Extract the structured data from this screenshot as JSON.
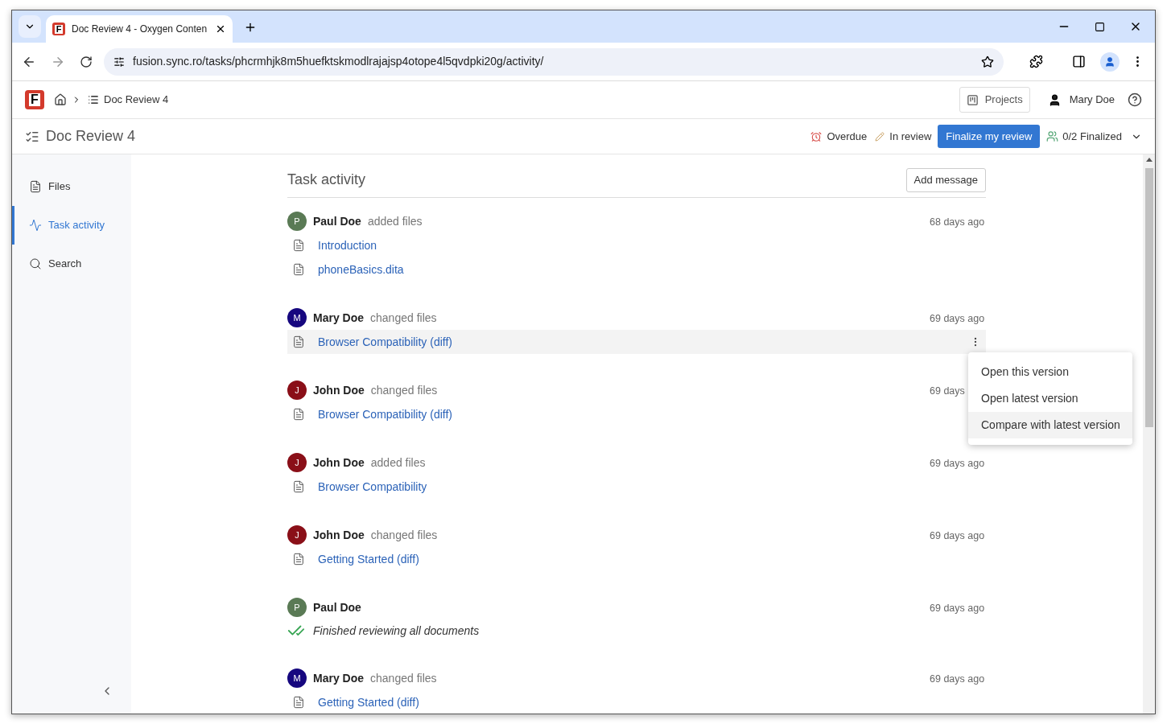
{
  "browser": {
    "tab": {
      "favicon_letter": "F",
      "title": "Doc Review 4 - Oxygen Conten"
    },
    "url": "fusion.sync.ro/tasks/phcrmhjk8m5huefktskmodlrajajsp4otope4l5qvdpki20g/activity/"
  },
  "app": {
    "logo_letter": "F",
    "breadcrumb": "Doc Review 4",
    "projects_button": "Projects",
    "user": "Mary Doe"
  },
  "task_header": {
    "title": "Doc Review 4",
    "overdue": "Overdue",
    "status": "In review",
    "finalize_button": "Finalize my review",
    "finalized": "0/2 Finalized"
  },
  "sidebar": {
    "items": [
      {
        "label": "Files",
        "selected": false
      },
      {
        "label": "Task activity",
        "selected": true
      },
      {
        "label": "Search",
        "selected": false
      }
    ]
  },
  "activity": {
    "title": "Task activity",
    "add_button": "Add message",
    "entries": [
      {
        "kind": "files",
        "initial": "P",
        "color": "#5a7a55",
        "user": "Paul Doe",
        "action": "added files",
        "time": "68 days ago",
        "files": [
          {
            "name": "Introduction",
            "selected": false
          },
          {
            "name": "phoneBasics.dita",
            "selected": false
          }
        ]
      },
      {
        "kind": "files",
        "initial": "M",
        "color": "#16077f",
        "user": "Mary Doe",
        "action": "changed files",
        "time": "69 days ago",
        "files": [
          {
            "name": "Browser Compatibility (diff)",
            "selected": true,
            "menu": [
              {
                "label": "Open this version",
                "selected": false
              },
              {
                "label": "Open latest version",
                "selected": false
              },
              {
                "label": "Compare with latest version",
                "selected": true
              }
            ]
          }
        ]
      },
      {
        "kind": "files",
        "initial": "J",
        "color": "#8a0f18",
        "user": "John Doe",
        "action": "changed files",
        "time": "69 days",
        "files": [
          {
            "name": "Browser Compatibility (diff)",
            "selected": false
          }
        ]
      },
      {
        "kind": "files",
        "initial": "J",
        "color": "#8a0f18",
        "user": "John Doe",
        "action": "added files",
        "time": "69 days ago",
        "files": [
          {
            "name": "Browser Compatibility",
            "selected": false
          }
        ]
      },
      {
        "kind": "files",
        "initial": "J",
        "color": "#8a0f18",
        "user": "John Doe",
        "action": "changed files",
        "time": "69 days ago",
        "files": [
          {
            "name": "Getting Started (diff)",
            "selected": false
          }
        ]
      },
      {
        "kind": "review",
        "initial": "P",
        "color": "#5a7a55",
        "user": "Paul Doe",
        "time": "69 days ago",
        "note": "Finished reviewing all documents"
      },
      {
        "kind": "files",
        "initial": "M",
        "color": "#16077f",
        "user": "Mary Doe",
        "action": "changed files",
        "time": "69 days ago",
        "files": [
          {
            "name": "Getting Started (diff)",
            "selected": false
          }
        ]
      }
    ]
  }
}
